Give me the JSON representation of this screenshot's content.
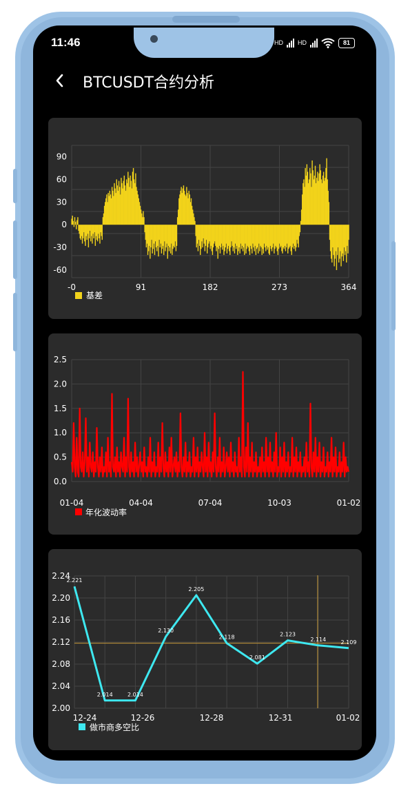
{
  "status_bar": {
    "time": "11:46",
    "network_1": "HD",
    "network_2": "HD",
    "battery": "81"
  },
  "header": {
    "title": "BTCUSDT合约分析",
    "back_icon": "chevron-left-icon"
  },
  "chart_data": [
    {
      "type": "bar",
      "title": "",
      "legend": [
        {
          "name": "基差",
          "color": "#f2d31b"
        }
      ],
      "x_ticks": [
        "-0",
        "91",
        "182",
        "273",
        "364"
      ],
      "y_ticks": [
        "90",
        "60",
        "30",
        "0",
        "-30",
        "-60"
      ],
      "ylim": [
        -70,
        105
      ],
      "xlim": [
        0,
        364
      ],
      "series": [
        {
          "name": "基差",
          "color": "#f2d31b",
          "segments": [
            {
              "x": [
                0,
                8
              ],
              "values": [
                8,
                12,
                5,
                -3,
                10,
                4,
                -6,
                6,
                10
              ]
            },
            {
              "x": [
                9,
                40
              ],
              "values": [
                -8,
                -12,
                -18,
                -20,
                -15,
                -25,
                -18,
                -10,
                -22,
                -28,
                -15,
                -20,
                -12,
                -30,
                -18,
                -8,
                -22,
                -15,
                -25,
                -12,
                -18,
                -10,
                -28,
                -15,
                -20,
                -22,
                -12,
                -18,
                -25,
                -10,
                -15,
                -20
              ]
            },
            {
              "x": [
                41,
                95
              ],
              "values": [
                10,
                15,
                25,
                30,
                35,
                40,
                30,
                42,
                38,
                45,
                40,
                35,
                50,
                45,
                38,
                55,
                48,
                42,
                60,
                52,
                45,
                58,
                50,
                40,
                62,
                55,
                48,
                58,
                65,
                52,
                45,
                60,
                55,
                70,
                62,
                50,
                65,
                58,
                48,
                70,
                75,
                60,
                55,
                68,
                50,
                45,
                40,
                35,
                30,
                25,
                20,
                15,
                10,
                18,
                10
              ]
            },
            {
              "x": [
                96,
                138
              ],
              "values": [
                -10,
                -20,
                -30,
                -25,
                -40,
                -35,
                -28,
                -45,
                -30,
                -20,
                -38,
                -32,
                -25,
                -40,
                -22,
                -30,
                -35,
                -28,
                -42,
                -20,
                -30,
                -25,
                -38,
                -32,
                -28,
                -40,
                -22,
                -35,
                -30,
                -25,
                -45,
                -28,
                -35,
                -30,
                -38,
                -25,
                -40,
                -32,
                -28,
                -30,
                -22,
                -35,
                -28
              ]
            },
            {
              "x": [
                139,
                162
              ],
              "values": [
                10,
                20,
                35,
                40,
                45,
                50,
                42,
                48,
                52,
                45,
                40,
                38,
                50,
                42,
                35,
                45,
                40,
                30,
                35,
                25,
                20,
                15,
                10,
                5
              ]
            },
            {
              "x": [
                163,
                300
              ],
              "values": [
                -15,
                -30,
                -25,
                -35,
                -20,
                -28,
                -40,
                -32,
                -22,
                -30,
                -18,
                -25,
                -35,
                -28,
                -20,
                -38,
                -30,
                -25,
                -22,
                -32,
                -28,
                -35,
                -40,
                -30,
                -25,
                -22,
                -28,
                -35,
                -30,
                -45,
                -32,
                -28,
                -38,
                -30,
                -25,
                -33,
                -28,
                -40,
                -35,
                -30,
                -25,
                -38,
                -32,
                -28,
                -35,
                -40,
                -30,
                -22,
                -28,
                -35,
                -30,
                -38,
                -25,
                -32,
                -28,
                -40,
                -35,
                -30,
                -38,
                -25,
                -32,
                -28,
                -35,
                -30,
                -40,
                -25,
                -38,
                -32,
                -28,
                -30,
                -35,
                -40,
                -28,
                -32,
                -38,
                -25,
                -30,
                -35,
                -28,
                -40,
                -32,
                -30,
                -38,
                -25,
                -35,
                -28,
                -30,
                -40,
                -32,
                -38,
                -25,
                -30,
                -35,
                -28,
                -33,
                -30,
                -38,
                -40,
                -28,
                -32,
                -35,
                -30,
                -25,
                -38,
                -32,
                -28,
                -30,
                -35,
                -40,
                -32,
                -25,
                -30,
                -28,
                -35,
                -38,
                -30,
                -32,
                -28,
                -35,
                -30,
                -25,
                -38,
                -32,
                -30,
                -28,
                -35,
                -40,
                -30,
                -25,
                -32,
                -28,
                -35,
                -30,
                -20,
                -25,
                -30,
                -15,
                -10
              ]
            },
            {
              "x": [
                301,
                338
              ],
              "values": [
                5,
                20,
                40,
                55,
                60,
                50,
                75,
                65,
                80,
                70,
                55,
                60,
                75,
                68,
                50,
                85,
                72,
                60,
                65,
                78,
                55,
                62,
                70,
                58,
                68,
                80,
                72,
                60,
                55,
                65,
                70,
                58,
                62,
                75,
                88,
                60,
                45,
                30
              ]
            },
            {
              "x": [
                339,
                364
              ],
              "values": [
                -20,
                -35,
                -45,
                -50,
                -30,
                -40,
                -55,
                -45,
                -35,
                -60,
                -40,
                -30,
                -50,
                -45,
                -35,
                -55,
                -42,
                -38,
                -48,
                -30,
                -40,
                -35,
                -50,
                -28,
                -38,
                -20
              ]
            }
          ]
        }
      ]
    },
    {
      "type": "line",
      "title": "",
      "legend": [
        {
          "name": "年化波动率",
          "color": "#ff0000"
        }
      ],
      "x_ticks": [
        "01-04",
        "04-04",
        "07-04",
        "10-03",
        "01-02"
      ],
      "y_ticks": [
        "2.5",
        "2.0",
        "1.5",
        "1.0",
        "0.5",
        "0.0"
      ],
      "ylim": [
        0,
        2.5
      ],
      "series": [
        {
          "name": "年化波动率",
          "color": "#ff0000",
          "values": [
            0.4,
            0.2,
            1.2,
            0.3,
            0.1,
            0.9,
            0.2,
            0.1,
            1.5,
            0.3,
            0.2,
            0.6,
            0.1,
            0.4,
            1.3,
            0.2,
            0.5,
            0.1,
            0.8,
            0.3,
            0.2,
            0.6,
            0.1,
            0.4,
            0.2,
            1.1,
            0.3,
            0.1,
            0.5,
            0.2,
            0.7,
            0.1,
            0.3,
            0.2,
            0.6,
            0.1,
            0.9,
            0.2,
            0.4,
            0.1,
            1.8,
            0.3,
            0.2,
            0.5,
            0.1,
            0.7,
            0.2,
            0.4,
            0.1,
            0.6,
            0.3,
            0.2,
            0.9,
            0.1,
            0.5,
            0.2,
            1.7,
            0.3,
            0.1,
            0.6,
            0.2,
            0.4,
            0.1,
            0.8,
            0.2,
            0.5,
            0.1,
            0.3,
            0.6,
            0.2,
            0.4,
            0.1,
            0.7,
            0.2,
            0.3,
            0.1,
            0.5,
            0.2,
            0.9,
            0.1,
            0.4,
            0.2,
            0.6,
            0.1,
            0.3,
            0.2,
            0.8,
            0.1,
            0.5,
            0.2,
            1.2,
            0.3,
            0.1,
            0.6,
            0.2,
            0.4,
            0.1,
            0.7,
            0.2,
            0.9,
            0.1,
            0.3,
            0.5,
            0.2,
            0.6,
            0.1,
            0.4,
            0.2,
            1.4,
            0.3,
            0.1,
            0.5,
            0.2,
            0.8,
            0.1,
            0.4,
            0.2,
            0.6,
            0.1,
            0.3,
            0.2,
            0.9,
            0.1,
            0.5,
            0.2,
            0.7,
            0.1,
            0.4,
            0.2,
            0.6,
            0.3,
            0.1,
            1.0,
            0.2,
            0.5,
            0.1,
            0.8,
            0.2,
            0.4,
            0.1,
            0.6,
            0.2,
            1.4,
            0.3,
            0.1,
            0.5,
            0.2,
            0.9,
            0.1,
            0.4,
            0.2,
            0.7,
            0.1,
            0.3,
            0.6,
            0.2,
            0.5,
            0.1,
            0.8,
            0.2,
            0.4,
            0.1,
            0.6,
            0.2,
            0.3,
            0.1,
            0.9,
            0.2,
            0.5,
            0.1,
            2.25,
            0.3,
            0.1,
            0.7,
            0.2,
            1.2,
            0.1,
            0.5,
            0.2,
            0.8,
            0.1,
            0.4,
            0.2,
            0.6,
            0.1,
            0.3,
            0.2,
            0.5,
            0.1,
            0.7,
            0.2,
            0.4,
            0.1,
            0.9,
            0.2,
            0.5,
            0.1,
            0.8,
            0.2,
            0.4,
            0.1,
            0.6,
            0.2,
            1.0,
            0.1,
            0.3,
            0.2,
            0.7,
            0.1,
            0.5,
            0.2,
            0.8,
            0.1,
            0.4,
            0.2,
            0.6,
            0.1,
            0.3,
            0.2,
            0.9,
            0.1,
            0.5,
            0.2,
            0.7,
            0.1,
            0.4,
            0.2,
            0.6,
            0.1,
            0.3,
            0.2,
            0.5,
            0.1,
            0.8,
            0.2,
            0.4,
            0.1,
            1.6,
            0.3,
            0.1,
            0.6,
            0.2,
            0.9,
            0.1,
            0.5,
            0.2,
            0.8,
            0.1,
            0.4,
            0.2,
            0.7,
            0.1,
            0.3,
            0.2,
            0.6,
            0.1,
            0.4,
            0.2,
            0.9,
            0.1,
            0.5,
            0.2,
            0.7,
            0.1,
            0.3,
            0.2,
            0.6,
            0.1,
            0.4,
            0.2,
            0.8,
            0.1,
            0.5,
            0.2,
            0.3,
            0.2
          ]
        }
      ]
    },
    {
      "type": "line",
      "title": "",
      "legend": [
        {
          "name": "做市商多空比",
          "color": "#3ee8f0"
        }
      ],
      "x_ticks": [
        "12-24",
        "12-26",
        "12-28",
        "12-31",
        "01-02"
      ],
      "y_ticks": [
        "2.24",
        "2.20",
        "2.16",
        "2.12",
        "2.08",
        "2.04",
        "2.00"
      ],
      "ylim": [
        2.0,
        2.24
      ],
      "reference_line": 2.118,
      "series": [
        {
          "name": "做市商多空比",
          "color": "#3ee8f0",
          "points": [
            {
              "x": 0,
              "y": 2.221,
              "label": "2.221"
            },
            {
              "x": 1,
              "y": 2.014,
              "label": "2.014"
            },
            {
              "x": 2,
              "y": 2.014,
              "label": "2.014"
            },
            {
              "x": 3,
              "y": 2.13,
              "label": "2.130"
            },
            {
              "x": 4,
              "y": 2.205,
              "label": "2.205"
            },
            {
              "x": 5,
              "y": 2.118,
              "label": "2.118"
            },
            {
              "x": 6,
              "y": 2.081,
              "label": "2.081"
            },
            {
              "x": 7,
              "y": 2.123,
              "label": "2.123"
            },
            {
              "x": 8,
              "y": 2.114,
              "label": "2.114"
            },
            {
              "x": 9,
              "y": 2.109,
              "label": "2.109"
            }
          ]
        }
      ]
    }
  ]
}
